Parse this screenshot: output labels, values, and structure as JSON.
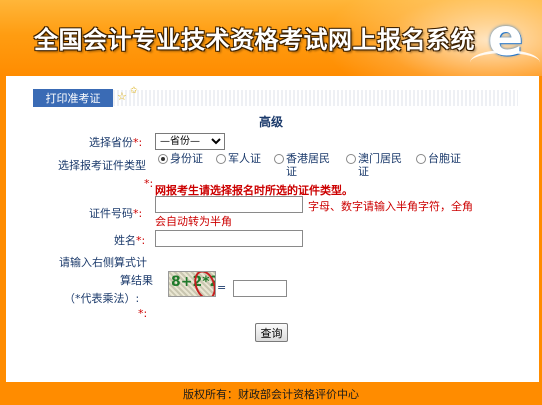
{
  "header": {
    "title": "全国会计专业技术资格考试网上报名系统",
    "logo_letter": "e"
  },
  "tab": {
    "label": "打印准考证"
  },
  "form": {
    "section_title": "高级",
    "province": {
      "label": "选择省份",
      "required_mark": "*:",
      "selected": "—省份—"
    },
    "id_type": {
      "label": "选择报考证件类型",
      "required_mark": "*:",
      "options": [
        {
          "label": "身份证",
          "selected": true
        },
        {
          "label": "军人证",
          "selected": false
        },
        {
          "label_line1": "香港居民",
          "label_line2": "证",
          "selected": false
        },
        {
          "label_line1": "澳门居民",
          "label_line2": "证",
          "selected": false
        },
        {
          "label": "台胞证",
          "selected": false
        }
      ],
      "warning": "网报考生请选择报名时所选的证件类型。"
    },
    "id_number": {
      "label": "证件号码",
      "required_mark": "*:",
      "value": "",
      "hint_line1": "字母、数字请输入半角字符，全角",
      "hint_line2": "会自动转为半角"
    },
    "name": {
      "label": "姓名",
      "required_mark": "*:",
      "value": ""
    },
    "captcha": {
      "label_line1": "请输入右侧算式计",
      "label_line2": "算结果",
      "label_line3": "（*代表乘法）",
      "colon": ":",
      "required_mark": "*:",
      "image_text": "8+2*2",
      "equals": "=",
      "answer": ""
    },
    "submit_label": "查询"
  },
  "footer": {
    "text": "版权所有：财政部会计资格评价中心"
  },
  "colors": {
    "banner": "#ff9d12",
    "tab": "#3a6bb5",
    "label": "#1b3a6b",
    "required": "#cc0000"
  }
}
